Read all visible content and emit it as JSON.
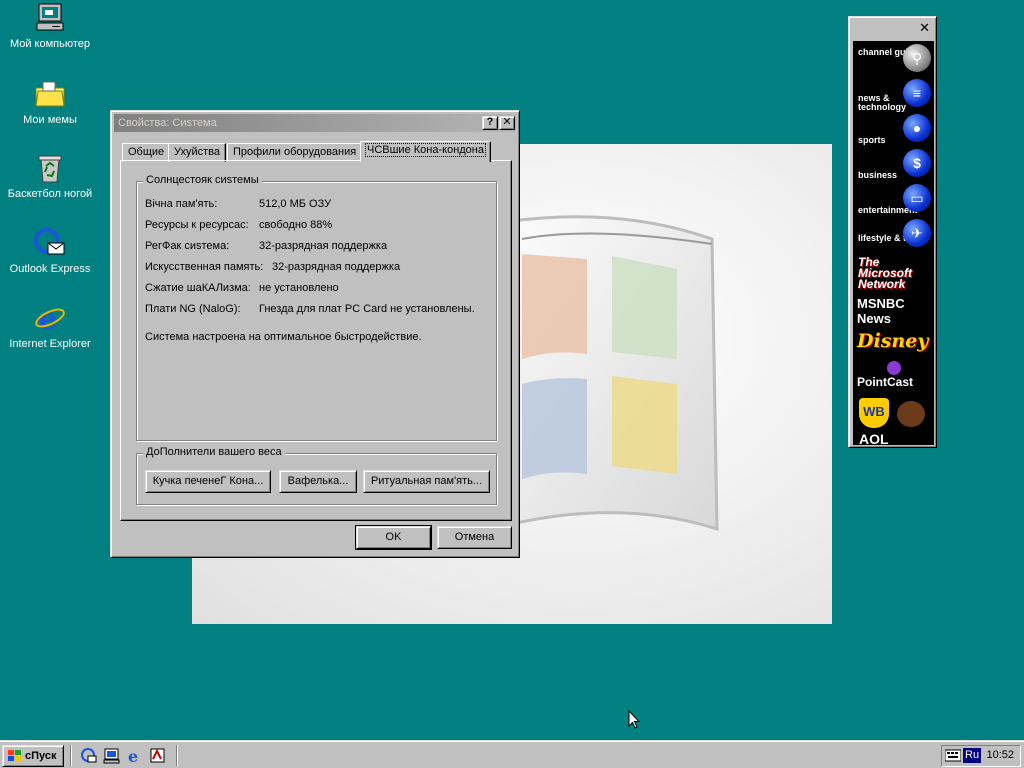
{
  "desktop": {
    "icons": [
      {
        "label": "Мой компьютер"
      },
      {
        "label": "Мои мемы"
      },
      {
        "label": "Баскетбол ногой"
      },
      {
        "label": "Outlook Express"
      },
      {
        "label": "Internet Explorer"
      }
    ]
  },
  "dialog": {
    "title": "Свойства: Сиsтема",
    "help_btn": "?",
    "close_btn": "✕",
    "tabs": [
      "Общие",
      "Ухуйства",
      "Профили оборудования",
      "ЧСВшие Кона-кондона"
    ],
    "active_tab": 3,
    "group1": {
      "legend": "Солнцестояк сиsтемы",
      "rows": [
        {
          "key": "Вічна пам'ять:",
          "value": "512,0 МБ ОЗУ"
        },
        {
          "key": "Ресурсы к ресурсас:",
          "value": "свободно 88%"
        },
        {
          "key": "РегФак сиsтема:",
          "value": "32-разрядная поддержка"
        },
        {
          "key": "Искусственная память:",
          "value": "32-разрядная поддержка"
        },
        {
          "key": "Сжатие шаКАЛизма:",
          "value": "не установлено"
        },
        {
          "key": "Плати NG (NaloG):",
          "value": "Гнезда для плат PC Card не установлены."
        }
      ],
      "status": "Система настроена на оптимальное быстродействие."
    },
    "group2": {
      "legend": "ДоПолнители вашего веса",
      "buttons": [
        "Кучка печенеГ Кона...",
        "Вафелька...",
        "Ритуальная пам'ять..."
      ]
    },
    "ok_label": "OK",
    "cancel_label": "Отмена"
  },
  "channelbar": {
    "close": "✕",
    "items": [
      {
        "label": "channel guide",
        "icon": "magnifier-icon"
      },
      {
        "label": "news & technology",
        "icon": "newspaper-icon"
      },
      {
        "label": "sports",
        "icon": "ball-icon"
      },
      {
        "label": "business",
        "icon": "dollar-icon"
      },
      {
        "label": "entertainment",
        "icon": "tv-icon"
      },
      {
        "label": "lifestyle & travel",
        "icon": "plane-icon"
      }
    ],
    "brands": [
      "The Microsoft Network",
      "MSNBC News",
      "Disney",
      "PointCast",
      "WB",
      "AOL"
    ]
  },
  "taskbar": {
    "start_label": "сПуск",
    "language": "Ru",
    "clock": "10:52"
  },
  "colors": {
    "desktop": "#008080",
    "chrome": "#c0c0c0",
    "inactive_title_start": "#808080",
    "inactive_title_end": "#b5b5b5"
  }
}
